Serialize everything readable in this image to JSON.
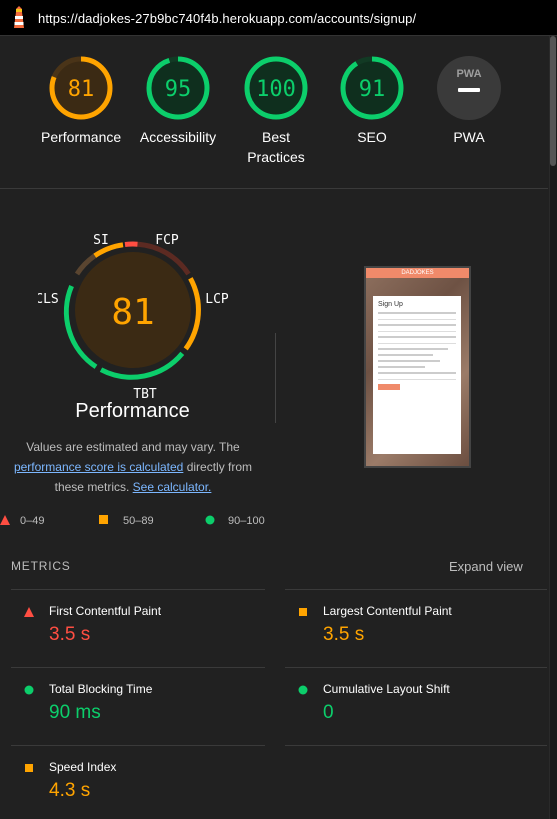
{
  "browser": {
    "url": "https://dadjokes-27b9bc740f4b.herokuapp.com/accounts/signup/"
  },
  "gauges": [
    {
      "score": "81",
      "label": "Performance",
      "fraction": 0.81,
      "color": "#ffa400"
    },
    {
      "score": "95",
      "label": "Accessibility",
      "fraction": 0.95,
      "color": "#0cce6b"
    },
    {
      "score": "100",
      "label_line1": "Best",
      "label_line2": "Practices",
      "fraction": 1.0,
      "color": "#0cce6b"
    },
    {
      "score": "91",
      "label": "SEO",
      "fraction": 0.91,
      "color": "#0cce6b"
    },
    {
      "pwa_badge": "PWA",
      "label": "PWA"
    }
  ],
  "performance": {
    "score": "81",
    "title": "Performance",
    "segment_labels": {
      "si": "SI",
      "fcp": "FCP",
      "lcp": "LCP",
      "tbt": "TBT",
      "cls": "CLS"
    },
    "note_line1": "Values are estimated and may vary. The",
    "note_link1": "performance score is calculated",
    "note_mid": " directly from",
    "note_line3_pre": "these metrics. ",
    "note_link2": "See calculator."
  },
  "legend": {
    "fail": "0–49",
    "average": "50–89",
    "pass": "90–100"
  },
  "screenshot": {
    "brand": "DADJOKES",
    "heading": "Sign Up"
  },
  "metrics": {
    "heading": "METRICS",
    "expand_label": "Expand view",
    "items": [
      {
        "name": "First Contentful Paint",
        "value": "3.5 s",
        "status": "fail"
      },
      {
        "name": "Largest Contentful Paint",
        "value": "3.5 s",
        "status": "average"
      },
      {
        "name": "Total Blocking Time",
        "value": "90 ms",
        "status": "pass"
      },
      {
        "name": "Cumulative Layout Shift",
        "value": "0",
        "status": "pass"
      },
      {
        "name": "Speed Index",
        "value": "4.3 s",
        "status": "average"
      }
    ]
  },
  "colors": {
    "fail": "#ff4e42",
    "average": "#ffa400",
    "pass": "#0cce6b"
  }
}
